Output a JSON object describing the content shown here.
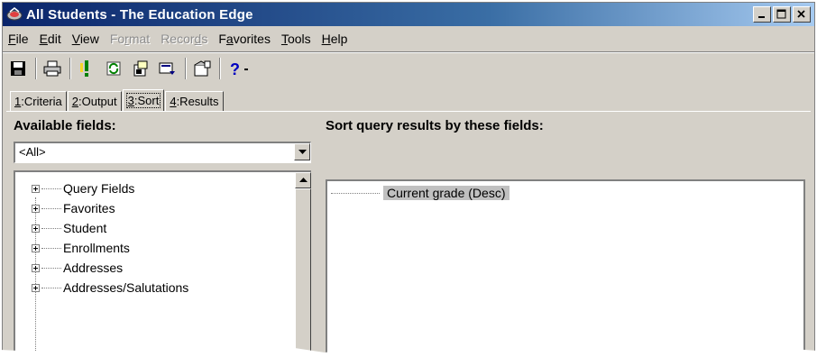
{
  "window": {
    "title": "All Students - The Education Edge",
    "title_icon": "education-edge-app-icon",
    "controls": [
      "minimize",
      "maximize",
      "close"
    ]
  },
  "menubar": {
    "items": [
      {
        "label": "File",
        "enabled": true
      },
      {
        "label": "Edit",
        "enabled": true
      },
      {
        "label": "View",
        "enabled": true
      },
      {
        "label": "Format",
        "enabled": false
      },
      {
        "label": "Records",
        "enabled": false
      },
      {
        "label": "Favorites",
        "enabled": true
      },
      {
        "label": "Tools",
        "enabled": true
      },
      {
        "label": "Help",
        "enabled": true
      }
    ]
  },
  "toolbar": {
    "buttons": [
      "save-icon",
      "print-icon",
      "run-query-icon",
      "refresh-icon",
      "export-icon",
      "merge-icon",
      "properties-icon",
      "help-icon"
    ]
  },
  "tabs": [
    {
      "label": "1:Criteria",
      "active": false
    },
    {
      "label": "2:Output",
      "active": false
    },
    {
      "label": "3:Sort",
      "active": true
    },
    {
      "label": "4:Results",
      "active": false
    }
  ],
  "available": {
    "heading": "Available fields:",
    "filter_value": "<All>",
    "tree_items": [
      "Query Fields",
      "Favorites",
      "Student",
      "Enrollments",
      "Addresses",
      "Addresses/Salutations"
    ]
  },
  "sort": {
    "heading": "Sort query results by these fields:",
    "items": [
      "Current grade (Desc)"
    ]
  },
  "colors": {
    "titlebar_start": "#0a246a",
    "titlebar_end": "#a6caf0",
    "face": "#d4d0c8",
    "selection": "#c0c0c0"
  }
}
